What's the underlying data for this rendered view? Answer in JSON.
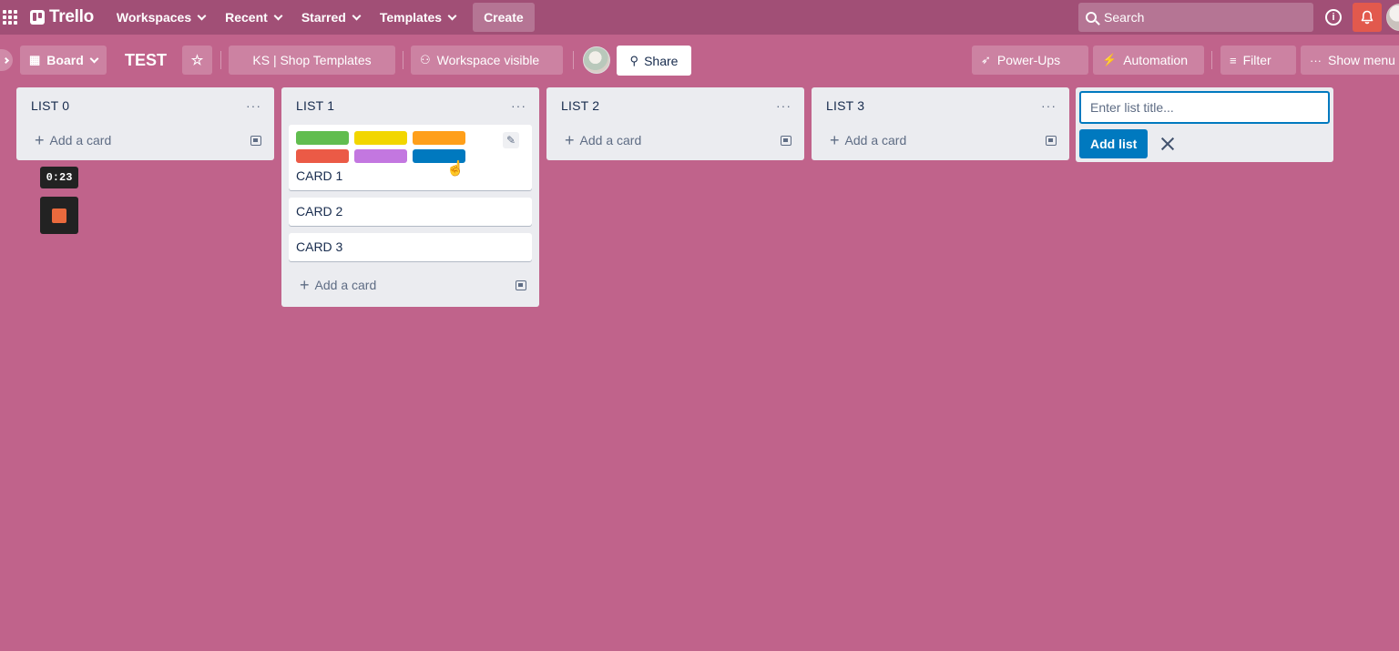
{
  "header": {
    "logo_text": "Trello",
    "nav": [
      {
        "label": "Workspaces"
      },
      {
        "label": "Recent"
      },
      {
        "label": "Starred"
      },
      {
        "label": "Templates"
      }
    ],
    "create_label": "Create",
    "search_label": "Search"
  },
  "board": {
    "view_label": "Board",
    "title": "TEST",
    "workspace_label": "KS | Shop Templates",
    "visibility_label": "Workspace visible",
    "share_label": "Share",
    "powerups_label": "Power-Ups",
    "automation_label": "Automation",
    "filter_label": "Filter",
    "show_menu_label": "Show menu"
  },
  "lists": [
    {
      "title": "LIST 0",
      "add_card": "Add a card",
      "cards": []
    },
    {
      "title": "LIST 1",
      "add_card": "Add a card",
      "cards": [
        {
          "title": "CARD 1",
          "labels": [
            "#61bd4f",
            "#f2d600",
            "#ff9f1a",
            "#eb5a46",
            "#c377e0",
            "#0079bf"
          ]
        },
        {
          "title": "CARD 2",
          "labels": []
        },
        {
          "title": "CARD 3",
          "labels": []
        }
      ]
    },
    {
      "title": "LIST 2",
      "add_card": "Add a card",
      "cards": []
    },
    {
      "title": "LIST 3",
      "add_card": "Add a card",
      "cards": []
    }
  ],
  "add_list": {
    "placeholder": "Enter list title...",
    "button_label": "Add list"
  },
  "timer": {
    "value": "0:23"
  },
  "colors": {
    "board_bg": "#c0638b",
    "header_bg": "#a14f76",
    "accent_blue": "#0079bf",
    "notification_red": "#e2594d"
  }
}
